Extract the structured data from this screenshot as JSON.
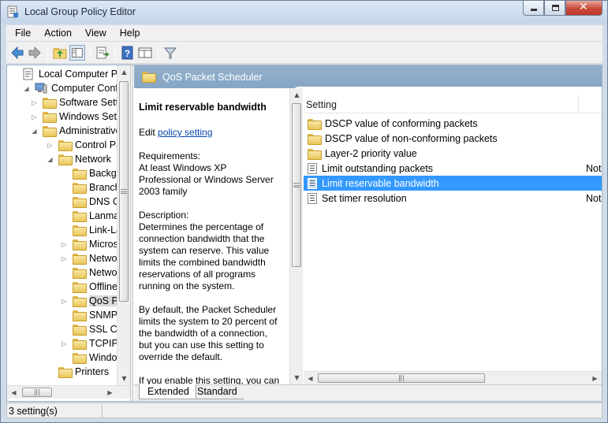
{
  "window": {
    "title": "Local Group Policy Editor",
    "minimize_icon": "minimize-icon",
    "maximize_icon": "maximize-icon",
    "close_icon": "close-icon",
    "close_glyph": "✕"
  },
  "menu": [
    "File",
    "Action",
    "View",
    "Help"
  ],
  "toolbar": {
    "icons": [
      "back-arrow-icon",
      "forward-arrow-icon",
      "up-folder-icon",
      "show-hide-tree-icon",
      "export-list-icon",
      "help-icon",
      "extended-view-icon",
      "filter-icon"
    ]
  },
  "tree": {
    "items": [
      {
        "label": "Local Computer Polic",
        "level": 0,
        "expander": "",
        "icon": "policy-document-icon"
      },
      {
        "label": "Computer Config",
        "level": 1,
        "expander": "◢",
        "icon": "computer-icon"
      },
      {
        "label": "Software Setti",
        "level": 2,
        "expander": "▷",
        "icon": "folder-icon"
      },
      {
        "label": "Windows Sett",
        "level": 2,
        "expander": "▷",
        "icon": "folder-icon"
      },
      {
        "label": "Administrative",
        "level": 2,
        "expander": "◢",
        "icon": "folder-icon"
      },
      {
        "label": "Control Pa",
        "level": 3,
        "expander": "▷",
        "icon": "folder-icon"
      },
      {
        "label": "Network",
        "level": 3,
        "expander": "◢",
        "icon": "folder-icon"
      },
      {
        "label": "Backgr",
        "level": 4,
        "expander": "",
        "icon": "folder-icon"
      },
      {
        "label": "Branch",
        "level": 4,
        "expander": "",
        "icon": "folder-icon"
      },
      {
        "label": "DNS C",
        "level": 4,
        "expander": "",
        "icon": "folder-icon"
      },
      {
        "label": "Lanma",
        "level": 4,
        "expander": "",
        "icon": "folder-icon"
      },
      {
        "label": "Link-La",
        "level": 4,
        "expander": "",
        "icon": "folder-icon"
      },
      {
        "label": "Micros",
        "level": 4,
        "expander": "▷",
        "icon": "folder-icon"
      },
      {
        "label": "Netwo",
        "level": 4,
        "expander": "▷",
        "icon": "folder-icon"
      },
      {
        "label": "Netwo",
        "level": 4,
        "expander": "",
        "icon": "folder-icon"
      },
      {
        "label": "Offline",
        "level": 4,
        "expander": "",
        "icon": "folder-icon"
      },
      {
        "label": "QoS Pa",
        "level": 4,
        "expander": "▷",
        "icon": "folder-icon",
        "selected": true
      },
      {
        "label": "SNMP",
        "level": 4,
        "expander": "",
        "icon": "folder-icon"
      },
      {
        "label": "SSL Co",
        "level": 4,
        "expander": "",
        "icon": "folder-icon"
      },
      {
        "label": "TCPIP",
        "level": 4,
        "expander": "▷",
        "icon": "folder-icon"
      },
      {
        "label": "Windo",
        "level": 4,
        "expander": "",
        "icon": "folder-icon"
      },
      {
        "label": "Printers",
        "level": 3,
        "expander": "",
        "icon": "folder-icon"
      }
    ]
  },
  "header": {
    "title": "QoS Packet Scheduler",
    "icon": "folder-icon"
  },
  "description": {
    "title": "Limit reservable bandwidth",
    "edit_prefix": "Edit ",
    "edit_link": "policy setting ",
    "requirements": "Requirements:",
    "requirements_text": "At least Windows XP Professional or Windows Server 2003 family",
    "description_label": "Description:",
    "description_text": "Determines the percentage of connection bandwidth that the system can reserve. This value limits the combined bandwidth reservations of all programs running on the system.",
    "default_text": "By default, the Packet Scheduler limits the system to 20 percent of the bandwidth of a connection, but you can use this setting to override the default.",
    "enable_text": "If you enable this setting, you can use the \"Bandwidth limit\" box to"
  },
  "list": {
    "column_setting": "Setting",
    "rows": [
      {
        "label": "DSCP value of conforming packets",
        "icon": "folder-icon",
        "state": ""
      },
      {
        "label": "DSCP value of non-conforming packets",
        "icon": "folder-icon",
        "state": ""
      },
      {
        "label": "Layer-2 priority value",
        "icon": "folder-icon",
        "state": ""
      },
      {
        "label": "Limit outstanding packets",
        "icon": "policy-setting-icon",
        "state": "Not"
      },
      {
        "label": "Limit reservable bandwidth",
        "icon": "policy-setting-icon",
        "state": "",
        "selected": true
      },
      {
        "label": "Set timer resolution",
        "icon": "policy-setting-icon",
        "state": "Not"
      }
    ]
  },
  "tabs": [
    "Extended",
    "Standard"
  ],
  "status": {
    "text": "3 setting(s)"
  },
  "scroll": {
    "arrow_up": "▲",
    "arrow_down": "▼",
    "arrow_left": "◀",
    "arrow_right": "▶"
  }
}
